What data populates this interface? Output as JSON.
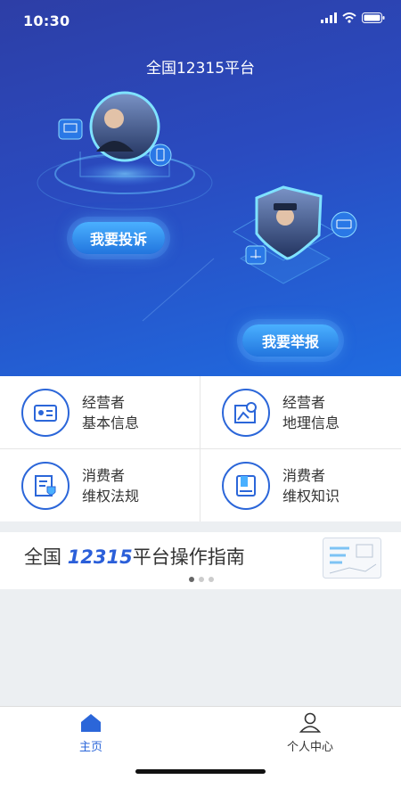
{
  "status_bar": {
    "time": "10:30"
  },
  "header": {
    "title": "全国12315平台"
  },
  "actions": {
    "complaint_label": "我要投诉",
    "report_label": "我要举报"
  },
  "services": [
    {
      "line1": "经营者",
      "line2": "基本信息",
      "icon": "id-card-icon"
    },
    {
      "line1": "经营者",
      "line2": "地理信息",
      "icon": "map-pin-icon"
    },
    {
      "line1": "消费者",
      "line2": "维权法规",
      "icon": "shield-document-icon"
    },
    {
      "line1": "消费者",
      "line2": "维权知识",
      "icon": "book-icon"
    }
  ],
  "guide": {
    "prefix": "全国 ",
    "number": "12315",
    "suffix": "平台操作指南",
    "slide_count": 3,
    "active_slide": 1
  },
  "tabbar": {
    "home_label": "主页",
    "profile_label": "个人中心"
  },
  "colors": {
    "accent": "#2b66d9",
    "hero_top": "#2d3ea6",
    "hero_bottom": "#1f6be0"
  }
}
